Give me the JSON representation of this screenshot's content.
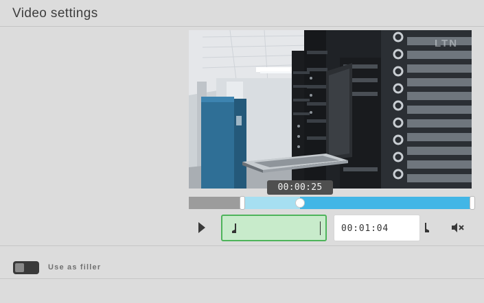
{
  "header": {
    "title": "Video settings"
  },
  "player": {
    "watermark": "LTN",
    "current_time": "00:00:25",
    "play_icon": "play-icon",
    "mute_icon": "mute-icon",
    "timeline": {
      "start_fraction": 0.19,
      "playhead_fraction": 0.39,
      "end_fraction": 1.0
    }
  },
  "trim": {
    "start": {
      "value": "",
      "icon": "mark-in-icon"
    },
    "end": {
      "value": "00:01:04",
      "icon": "mark-out-icon"
    }
  },
  "filler": {
    "label": "Use as filler",
    "enabled": false
  },
  "colors": {
    "accent": "#42b6e6",
    "played": "#a6dff1",
    "trim_active_bg": "#c8ebcb",
    "trim_active_border": "#4db35a"
  }
}
